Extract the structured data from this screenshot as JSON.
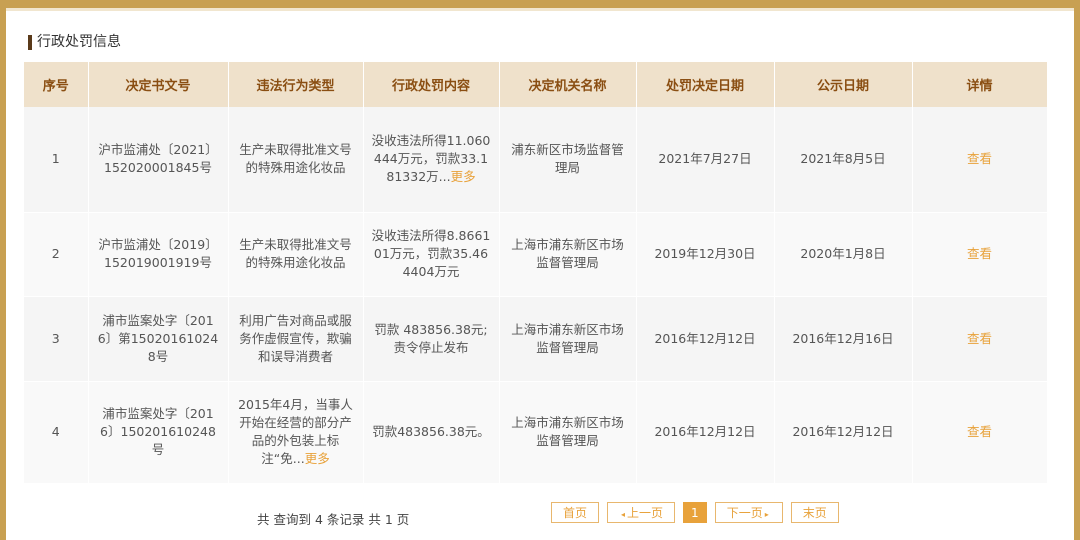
{
  "section": {
    "title": "行政处罚信息"
  },
  "table": {
    "headers": [
      "序号",
      "决定书文号",
      "违法行为类型",
      "行政处罚内容",
      "决定机关名称",
      "处罚决定日期",
      "公示日期",
      "详情"
    ],
    "rows": [
      {
        "no": "1",
        "doc": "沪市监浦处〔2021〕152020001845号",
        "type": "生产未取得批准文号的特殊用途化妆品",
        "content": "没收违法所得11.060444万元，罚款33.181332万...",
        "authority": "浦东新区市场监督管理局",
        "decided": "2021年7月27日",
        "published": "2021年8月5日",
        "detail": "查看"
      },
      {
        "no": "2",
        "doc": "沪市监浦处〔2019〕152019001919号",
        "type": "生产未取得批准文号的特殊用途化妆品",
        "content": "没收违法所得8.866101万元，罚款35.464404万元",
        "authority": "上海市浦东新区市场监督管理局",
        "decided": "2019年12月30日",
        "published": "2020年1月8日",
        "detail": "查看"
      },
      {
        "no": "3",
        "doc": "浦市监案处字〔2016〕第150201610248号",
        "type": "利用广告对商品或服务作虚假宣传，欺骗和误导消费者",
        "content": "罚款 483856.38元;责令停止发布",
        "authority": "上海市浦东新区市场监督管理局",
        "decided": "2016年12月12日",
        "published": "2016年12月16日",
        "detail": "查看"
      },
      {
        "no": "4",
        "doc": "浦市监案处字〔2016〕150201610248号",
        "type": "2015年4月，当事人开始在经营的部分产品的外包装上标注“免...",
        "content": "罚款483856.38元。",
        "authority": "上海市浦东新区市场监督管理局",
        "decided": "2016年12月12日",
        "published": "2016年12月12日",
        "detail": "查看"
      }
    ],
    "more_label": "更多"
  },
  "footer": {
    "summary": "共 查询到 4 条记录 共 1 页",
    "first": "首页",
    "prev": "上一页",
    "current": "1",
    "next": "下一页",
    "last": "末页"
  },
  "colors": {
    "accent": "#e8a23b",
    "frame": "#c8a052",
    "header_bg": "#efe1cb",
    "header_text": "#8a4e12"
  }
}
